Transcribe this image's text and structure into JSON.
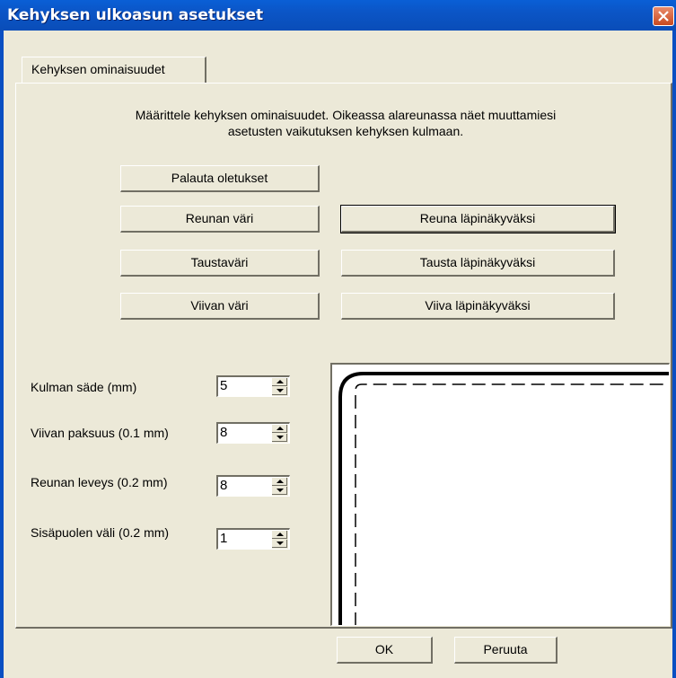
{
  "window": {
    "title": "Kehyksen ulkoasun asetukset",
    "close_icon": "close-icon"
  },
  "tabs": [
    {
      "label": "Kehyksen ominaisuudet",
      "selected": true
    }
  ],
  "description": {
    "line1": "Määrittele kehyksen ominaisuudet. Oikeassa alareunassa näet muuttamiesi",
    "line2": "asetusten vaikutuksen kehyksen kulmaan."
  },
  "buttons": {
    "restore_defaults": "Palauta oletukset",
    "border_color": "Reunan väri",
    "border_transparent": "Reuna läpinäkyväksi",
    "background_color": "Taustaväri",
    "background_transparent": "Tausta läpinäkyväksi",
    "line_color": "Viivan väri",
    "line_transparent": "Viiva läpinäkyväksi",
    "ok": "OK",
    "cancel": "Peruuta"
  },
  "fields": [
    {
      "label": "Kulman säde (mm)",
      "value": "5"
    },
    {
      "label": "Viivan paksuus (0.1 mm)",
      "value": "8"
    },
    {
      "label": "Reunan leveys (0.2 mm)",
      "value": "8"
    },
    {
      "label": "Sisäpuolen väli (0.2 mm)",
      "value": "1"
    }
  ],
  "colors": {
    "titlebar": "#0a55c6",
    "dialog_bg": "#ece9d8",
    "close_button": "#d5592f"
  }
}
